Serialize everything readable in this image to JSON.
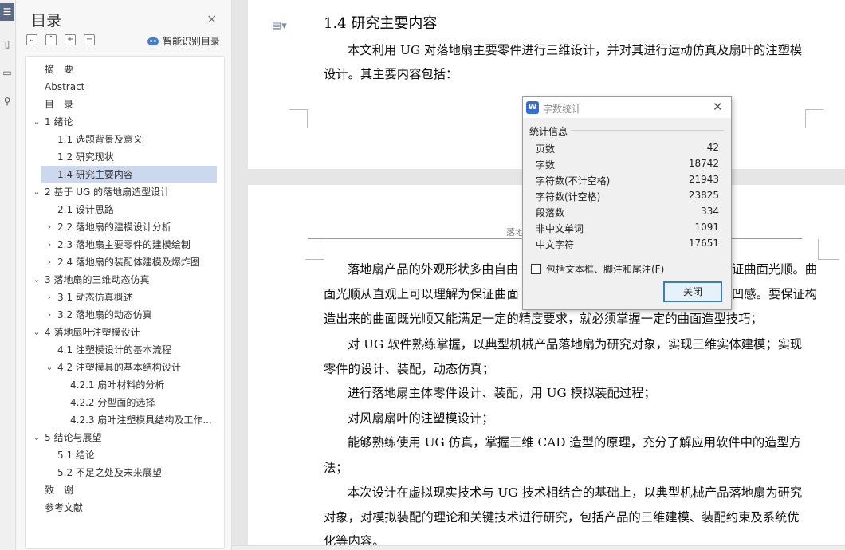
{
  "toc": {
    "title": "目录",
    "close_glyph": "×",
    "smart_label": "智能识别目录",
    "items": [
      {
        "label": "摘　要",
        "level": 0,
        "expand": ""
      },
      {
        "label": "Abstract",
        "level": 0,
        "expand": ""
      },
      {
        "label": "目　录",
        "level": 0,
        "expand": ""
      },
      {
        "label": "1  绪论",
        "level": 0,
        "expand": "v"
      },
      {
        "label": "1.1  选题背景及意义",
        "level": 1,
        "expand": ""
      },
      {
        "label": "1.2 研究现状",
        "level": 1,
        "expand": ""
      },
      {
        "label": "1.4  研究主要内容",
        "level": 1,
        "expand": "",
        "selected": true
      },
      {
        "label": "2  基于 UG 的落地扇造型设计",
        "level": 0,
        "expand": "v"
      },
      {
        "label": "2.1  设计思路",
        "level": 1,
        "expand": ""
      },
      {
        "label": "2.2  落地扇的建模设计分析",
        "level": 1,
        "expand": ">"
      },
      {
        "label": "2.3  落地扇主要零件的建模绘制",
        "level": 1,
        "expand": ">"
      },
      {
        "label": "2.4  落地扇的装配体建模及爆炸图",
        "level": 1,
        "expand": ">"
      },
      {
        "label": "3  落地扇的三维动态仿真",
        "level": 0,
        "expand": "v"
      },
      {
        "label": "3.1  动态仿真概述",
        "level": 1,
        "expand": ">"
      },
      {
        "label": "3.2  落地扇的动态仿真",
        "level": 1,
        "expand": ">"
      },
      {
        "label": "4  落地扇叶注塑模设计",
        "level": 0,
        "expand": "v"
      },
      {
        "label": "4.1  注塑模设计的基本流程",
        "level": 1,
        "expand": ""
      },
      {
        "label": "4.2  注塑模具的基本结构设计",
        "level": 1,
        "expand": "v"
      },
      {
        "label": "4.2.1  扇叶材料的分析",
        "level": 2,
        "expand": ""
      },
      {
        "label": "4.2.2  分型面的选择",
        "level": 2,
        "expand": ""
      },
      {
        "label": "4.2.3  扇叶注塑模具结构及工作...",
        "level": 2,
        "expand": ""
      },
      {
        "label": "5  结论与展望",
        "level": 0,
        "expand": "v"
      },
      {
        "label": "5.1 结论",
        "level": 1,
        "expand": ""
      },
      {
        "label": "5.2 不足之处及未来展望",
        "level": 1,
        "expand": ""
      },
      {
        "label": "致　谢",
        "level": 0,
        "expand": ""
      },
      {
        "label": "参考文献",
        "level": 0,
        "expand": ""
      }
    ]
  },
  "document": {
    "heading": "1.4  研究主要内容",
    "page1_lines": [
      "本文利用 UG 对落地扇主要零件进行三维设计，并对其进行运动仿真及扇叶的注塑模",
      "设计。其主要内容包括："
    ],
    "header_text": "落地",
    "page2_lines": [
      "落地扇产品的外观形状多由自由",
      "面光顺从直观上可以理解为保证曲面",
      "造出来的曲面既光顺又能满足一定的精度要求，就必须掌握一定的曲面造型技巧；",
      "对 UG 软件熟练掌握，以典型机械产品落地扇为研究对象，实现三维实体建模；实现",
      "零件的设计、装配，动态仿真；",
      "进行落地扇主体零件设计、装配，用 UG 模拟装配过程；",
      "对风扇扇叶的注塑模设计；",
      "能够熟练使用 UG 仿真，掌握三维 CAD 造型的原理，充分了解应用软件中的造型方",
      "法；",
      "本次设计在虚拟现实技术与 UG 技术相结合的基础上，以典型机械产品落地扇为研究",
      "对象，对模拟装配的理论和关键技术进行研究，包括产品的三维建模、装配约束及系统优",
      "化等内容。"
    ],
    "page2_right_fragments": [
      "证曲面光顺。曲",
      "凹感。要保证构"
    ]
  },
  "dialog": {
    "title": "字数统计",
    "group_label": "统计信息",
    "stats": [
      {
        "label": "页数",
        "value": "42"
      },
      {
        "label": "字数",
        "value": "18742"
      },
      {
        "label": "字符数(不计空格)",
        "value": "21943"
      },
      {
        "label": "字符数(计空格)",
        "value": "23825"
      },
      {
        "label": "段落数",
        "value": "334"
      },
      {
        "label": "非中文单词",
        "value": "1091"
      },
      {
        "label": "中文字符",
        "value": "17651"
      }
    ],
    "checkbox_label": "包括文本框、脚注和尾注(F)",
    "close_button": "关闭"
  }
}
